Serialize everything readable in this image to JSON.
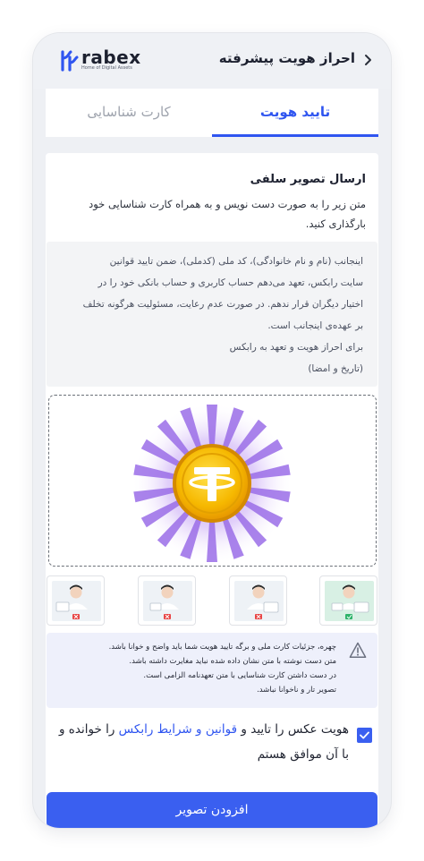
{
  "header": {
    "title": "احراز هویت پیشرفته",
    "back_icon": "chevron-right-icon",
    "logo": {
      "word": "rabex",
      "tagline": "Home of Digital Assets"
    }
  },
  "tabs": [
    {
      "label": "تایید هویت",
      "active": true
    },
    {
      "label": "کارت شناسایی",
      "active": false
    }
  ],
  "selfie": {
    "title": "ارسال تصویر سلفی",
    "description": "متن زیر را به صورت دست نویس و به همراه کارت شناسایی خود بارگذاری کنید.",
    "pledge_lines": [
      "اینجانب (نام و نام خانوادگی)، کد ملی (کدملی)، ضمن تایید قوانین",
      "سایت رابکس، تعهد می‌دهم حساب کاربری و حساب بانکی خود را در",
      "اختیار دیگران قرار ندهم. در صورت عدم رعایت، مسئولیت هرگونه تخلف",
      "بر عهده‌ی اینجانب است.",
      "برای احراز هویت و تعهد به رابکس",
      "(تاریخ و امضا)"
    ]
  },
  "upload_area": {
    "icon": "tether-coin-icon"
  },
  "examples": [
    {
      "status": "valid"
    },
    {
      "status": "invalid"
    },
    {
      "status": "invalid"
    },
    {
      "status": "invalid"
    }
  ],
  "notice": {
    "icon": "warning-icon",
    "lines": [
      "چهره، جزئیات کارت ملی و برگه تایید هویت شما باید واضح و خوانا باشد.",
      "متن دست نوشته با متن نشان داده شده نباید مغایرت داشته باشد.",
      "در دست داشتن کارت شناسایی با متن تعهدنامه الزامی است.",
      "تصویر تار و ناخوانا نباشد."
    ]
  },
  "agreement": {
    "checked": true,
    "before": "هویت عکس را تایید و ",
    "link": "قوانین و شرایط رابکس",
    "after": " را خوانده و با آن موافق هستم"
  },
  "submit_label": "افزودن تصویر",
  "colors": {
    "accent": "#3a5ff0",
    "tab_active": "#2f55f0",
    "coin": "#f5b800"
  }
}
